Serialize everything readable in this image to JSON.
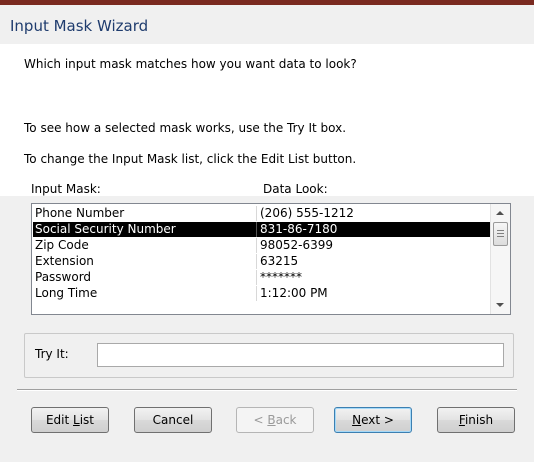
{
  "window": {
    "title": "Input Mask Wizard"
  },
  "header": {
    "question": "Which input mask matches how you want data to look?",
    "try_hint": "To see how a selected mask works, use the Try It box.",
    "edit_hint": "To change the Input Mask list, click the Edit List button."
  },
  "columns": {
    "input_mask": "Input Mask:",
    "data_look": "Data Look:"
  },
  "masks": [
    {
      "name": "Phone Number",
      "look": "(206) 555-1212"
    },
    {
      "name": "Social Security Number",
      "look": "831-86-7180",
      "selected": true
    },
    {
      "name": "Zip Code",
      "look": "98052-6399"
    },
    {
      "name": "Extension",
      "look": "63215"
    },
    {
      "name": "Password",
      "look": "*******"
    },
    {
      "name": "Long Time",
      "look": "1:12:00 PM"
    }
  ],
  "try_it": {
    "label": "Try It:",
    "value": ""
  },
  "buttons": {
    "edit_list": {
      "pre": "Edit ",
      "key": "L",
      "post": "ist"
    },
    "cancel": "Cancel",
    "back": {
      "pre": "< ",
      "key": "B",
      "post": "ack"
    },
    "next": {
      "pre": "",
      "key": "N",
      "post": "ext >"
    },
    "finish": {
      "pre": "",
      "key": "F",
      "post": "inish"
    }
  },
  "colors": {
    "title": "#1f3c6e",
    "selection_bg": "#000000",
    "selection_fg": "#ffffff",
    "titlebar_accent": "#7a2a20"
  }
}
